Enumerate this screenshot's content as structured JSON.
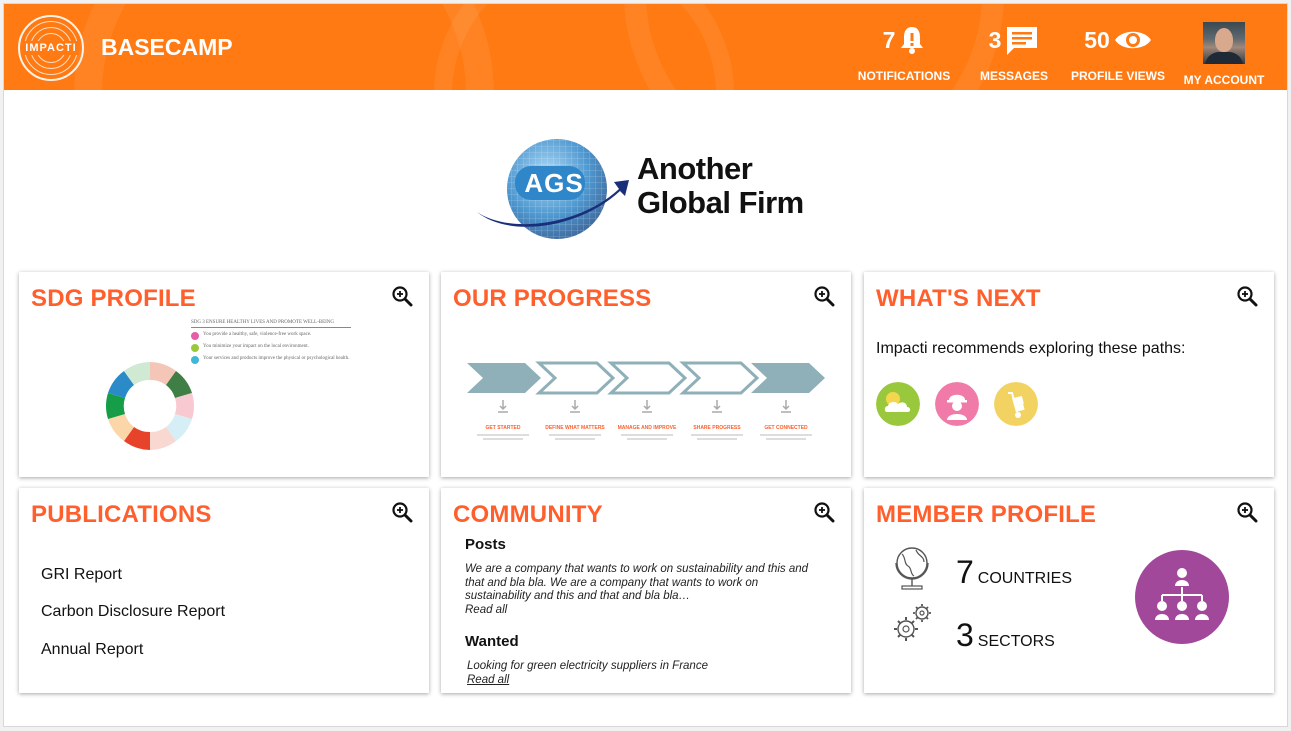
{
  "header": {
    "logo_text": "IMPACTI",
    "app_title": "BASECAMP",
    "notifications": {
      "count": "7",
      "label": "NOTIFICATIONS"
    },
    "messages": {
      "count": "3",
      "label": "MESSAGES"
    },
    "profile_views": {
      "count": "50",
      "label": "PROFILE VIEWS"
    },
    "account": {
      "label": "MY ACCOUNT"
    },
    "colors": {
      "header_bg": "#ff7a12"
    }
  },
  "company": {
    "logo_abbrev": "AGS",
    "name_line1": "Another",
    "name_line2": "Global Firm"
  },
  "cards": {
    "sdg_profile": {
      "title": "SDG PROFILE",
      "legend_header": "SDG 3  ENSURE HEALTHY LIVES AND PROMOTE WELL-BEING",
      "legend_rows": [
        "You provide a healthy, safe, violence-free work space.",
        "You minimize your impact on the local environment.",
        "Your services and products improve the physical or psychological health."
      ]
    },
    "our_progress": {
      "title": "OUR PROGRESS",
      "steps": [
        "GET STARTED",
        "DEFINE WHAT MATTERS",
        "MANAGE AND IMPROVE",
        "SHARE PROGRESS",
        "GET CONNECTED"
      ]
    },
    "whats_next": {
      "title": "WHAT'S NEXT",
      "text": "Impacti recommends exploring these paths:",
      "icons": [
        "weather-cloud-icon",
        "worker-icon",
        "hand-truck-icon"
      ]
    },
    "publications": {
      "title": "PUBLICATIONS",
      "items": [
        "GRI Report",
        "Carbon Disclosure Report",
        "Annual Report"
      ]
    },
    "community": {
      "title": "COMMUNITY",
      "posts_heading": "Posts",
      "posts_text": "We are a company that wants to work on sustainability and this and that and bla bla. We are a company that wants to work on sustainability and this and that and bla bla…",
      "posts_link": "Read all",
      "wanted_heading": "Wanted",
      "wanted_text": "Looking for green electricity suppliers in France",
      "wanted_link": "Read all"
    },
    "member_profile": {
      "title": "MEMBER PROFILE",
      "countries_num": "7",
      "countries_label": "COUNTRIES",
      "sectors_num": "3",
      "sectors_label": "SECTORS"
    }
  },
  "colors": {
    "accent_title": "#ff5f2c",
    "chevron": "#8fb0b8",
    "org_circle": "#a2489a",
    "icon_green": "#9ac83c",
    "icon_pink": "#f07aa8",
    "icon_yellow": "#f2d260"
  }
}
